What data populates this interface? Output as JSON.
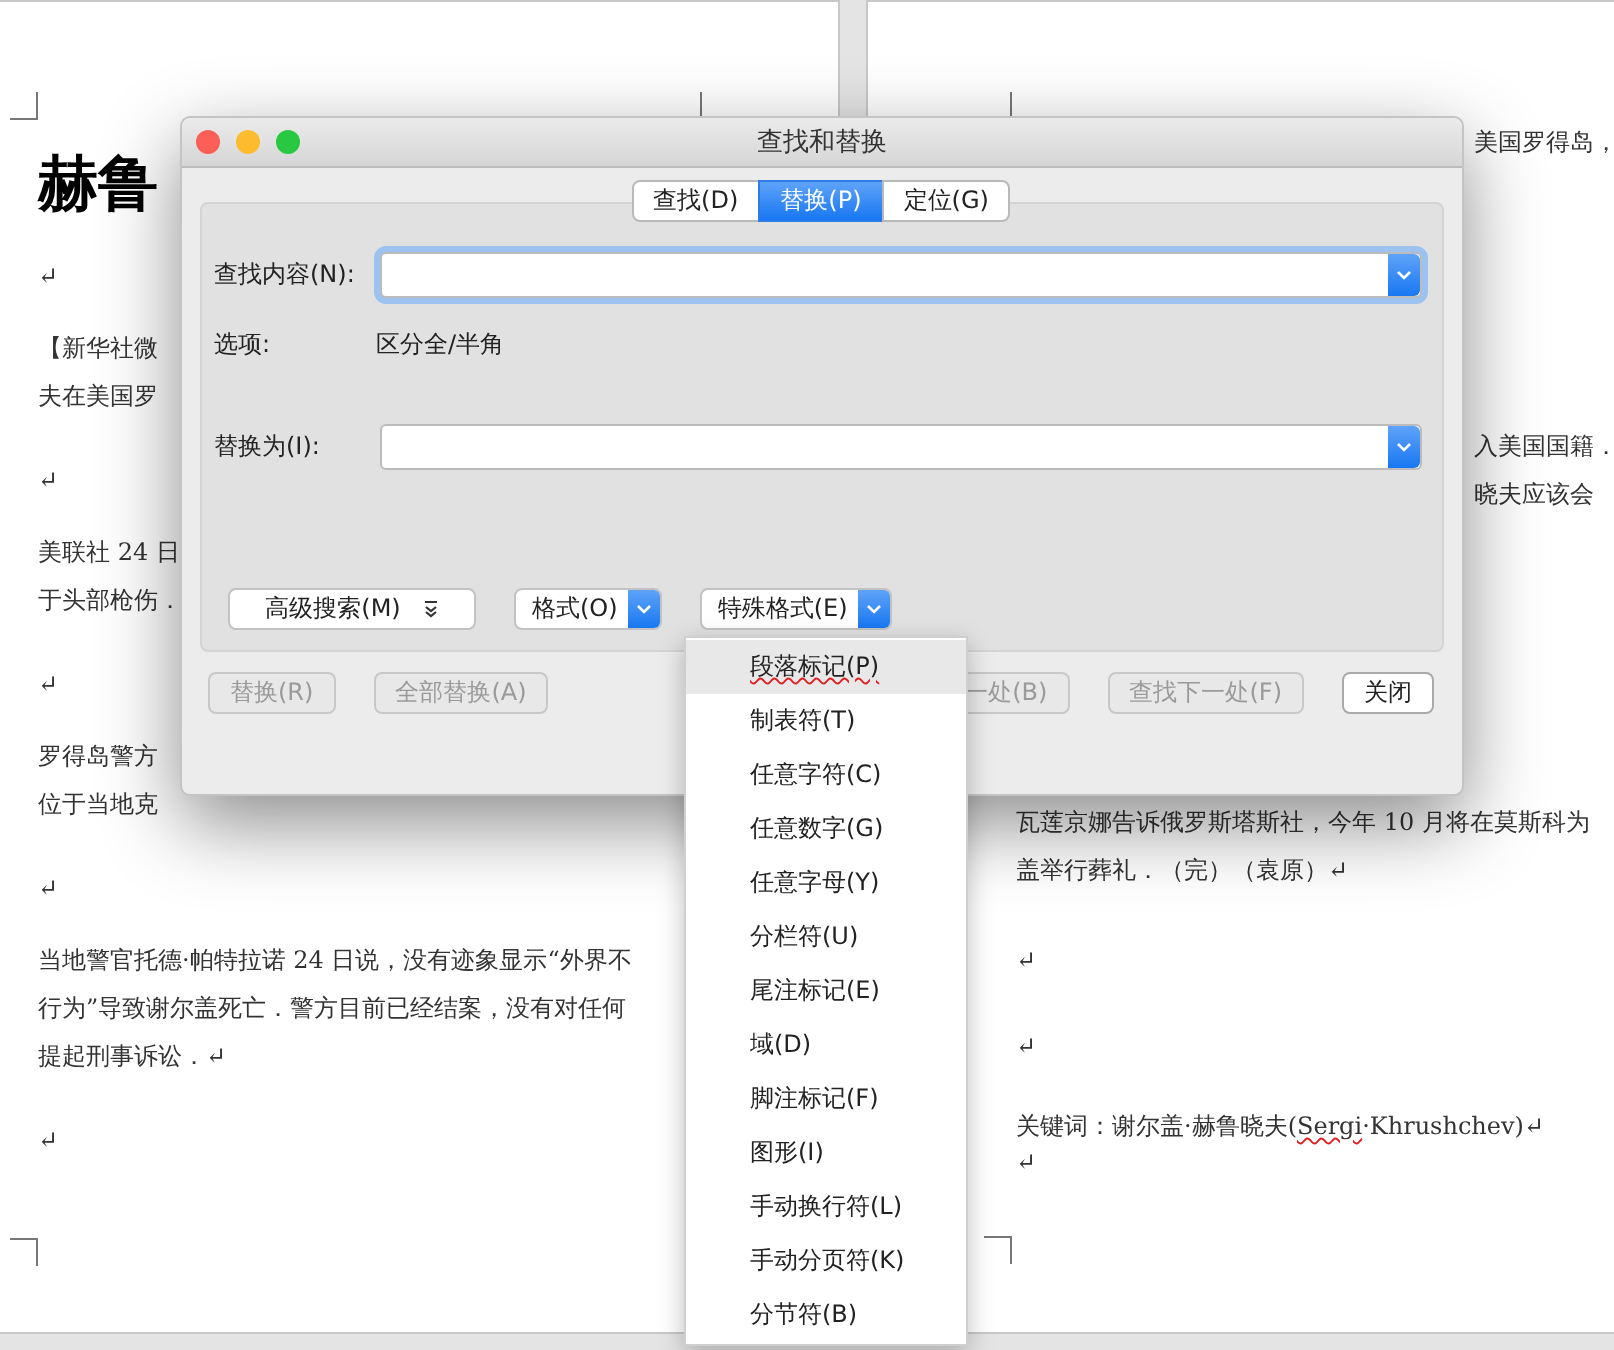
{
  "document": {
    "left_page": {
      "title": "赫鲁",
      "paragraphs": [
        {
          "kind": "blank",
          "lines": [
            "↵"
          ]
        },
        {
          "kind": "text",
          "lines": [
            "【新华社微",
            "夫在美国罗"
          ]
        },
        {
          "kind": "blank",
          "lines": [
            "↵"
          ]
        },
        {
          "kind": "text",
          "lines": [
            "美联社 24 日",
            "于头部枪伤．"
          ]
        },
        {
          "kind": "blank",
          "lines": [
            "↵"
          ]
        },
        {
          "kind": "text",
          "lines": [
            "罗得岛警方",
            "位于当地克"
          ]
        },
        {
          "kind": "blank",
          "lines": [
            "↵"
          ]
        },
        {
          "kind": "text",
          "lines": [
            "当地警官托德·帕特拉诺 24 日说，没有迹象显示“外界不",
            "行为”导致谢尔盖死亡．警方目前已经结案，没有对任何",
            "提起刑事诉讼．↵"
          ]
        },
        {
          "kind": "blank",
          "lines": [
            "↵"
          ]
        }
      ]
    },
    "right_page": {
      "paragraphs": [
        {
          "kind": "tail",
          "segments": [
            {
              "text": "美国罗得岛，"
            }
          ]
        },
        {
          "kind": "tail",
          "segments": [
            {
              "text": "入美国国籍．"
            }
          ]
        },
        {
          "kind": "tail",
          "segments": [
            {
              "text": "晓夫应该会"
            }
          ]
        },
        {
          "kind": "full",
          "segments": [
            {
              "text": "瓦莲京娜告诉俄罗斯塔斯社，今年 10 月将在莫斯科为"
            }
          ]
        },
        {
          "kind": "full",
          "segments": [
            {
              "text": "盖举行葬礼．（完）（袁原）↵"
            }
          ]
        },
        {
          "kind": "full",
          "segments": [
            {
              "text": "↵"
            }
          ]
        },
        {
          "kind": "full",
          "segments": [
            {
              "text": "↵"
            }
          ]
        },
        {
          "kind": "full",
          "segments": [
            {
              "text": "关键词：谢尔盖·赫鲁晓夫("
            },
            {
              "text": "Sergi",
              "misspelled": true
            },
            {
              "text": "·Khrushchev)↵"
            }
          ]
        },
        {
          "kind": "full",
          "segments": [
            {
              "text": "↵"
            }
          ]
        }
      ]
    }
  },
  "dialog": {
    "title": "查找和替换",
    "tabs": [
      {
        "label": "查找(D)",
        "selected": false
      },
      {
        "label": "替换(P)",
        "selected": true
      },
      {
        "label": "定位(G)",
        "selected": false
      }
    ],
    "find_label": "查找内容(N):",
    "options_label": "选项:",
    "options_value": "区分全/半角",
    "replace_label": "替换为(I):",
    "buttons": [
      {
        "label": "高级搜索(M)",
        "kind": "expander"
      },
      {
        "label": "格式(O)",
        "kind": "dropdown"
      },
      {
        "label": "特殊格式(E)",
        "kind": "dropdown"
      }
    ],
    "actions": [
      {
        "label": "替换(R)",
        "disabled": true
      },
      {
        "label": "全部替换(A)",
        "disabled": true
      },
      {
        "label": "一处(B)",
        "disabled": true
      },
      {
        "label": "查找下一处(F)",
        "disabled": true
      },
      {
        "label": "关闭",
        "disabled": false
      }
    ]
  },
  "menu": {
    "items": [
      {
        "label": "段落标记(P)",
        "selected": true,
        "misspelled": true
      },
      {
        "label": "制表符(T)",
        "selected": false
      },
      {
        "label": "任意字符(C)",
        "selected": false
      },
      {
        "label": "任意数字(G)",
        "selected": false
      },
      {
        "label": "任意字母(Y)",
        "selected": false
      },
      {
        "label": "分栏符(U)",
        "selected": false
      },
      {
        "label": "尾注标记(E)",
        "selected": false
      },
      {
        "label": "域(D)",
        "selected": false
      },
      {
        "label": "脚注标记(F)",
        "selected": false
      },
      {
        "label": "图形(I)",
        "selected": false
      },
      {
        "label": "手动换行符(L)",
        "selected": false
      },
      {
        "label": "手动分页符(K)",
        "selected": false
      },
      {
        "label": "分节符(B)",
        "selected": false
      }
    ]
  }
}
